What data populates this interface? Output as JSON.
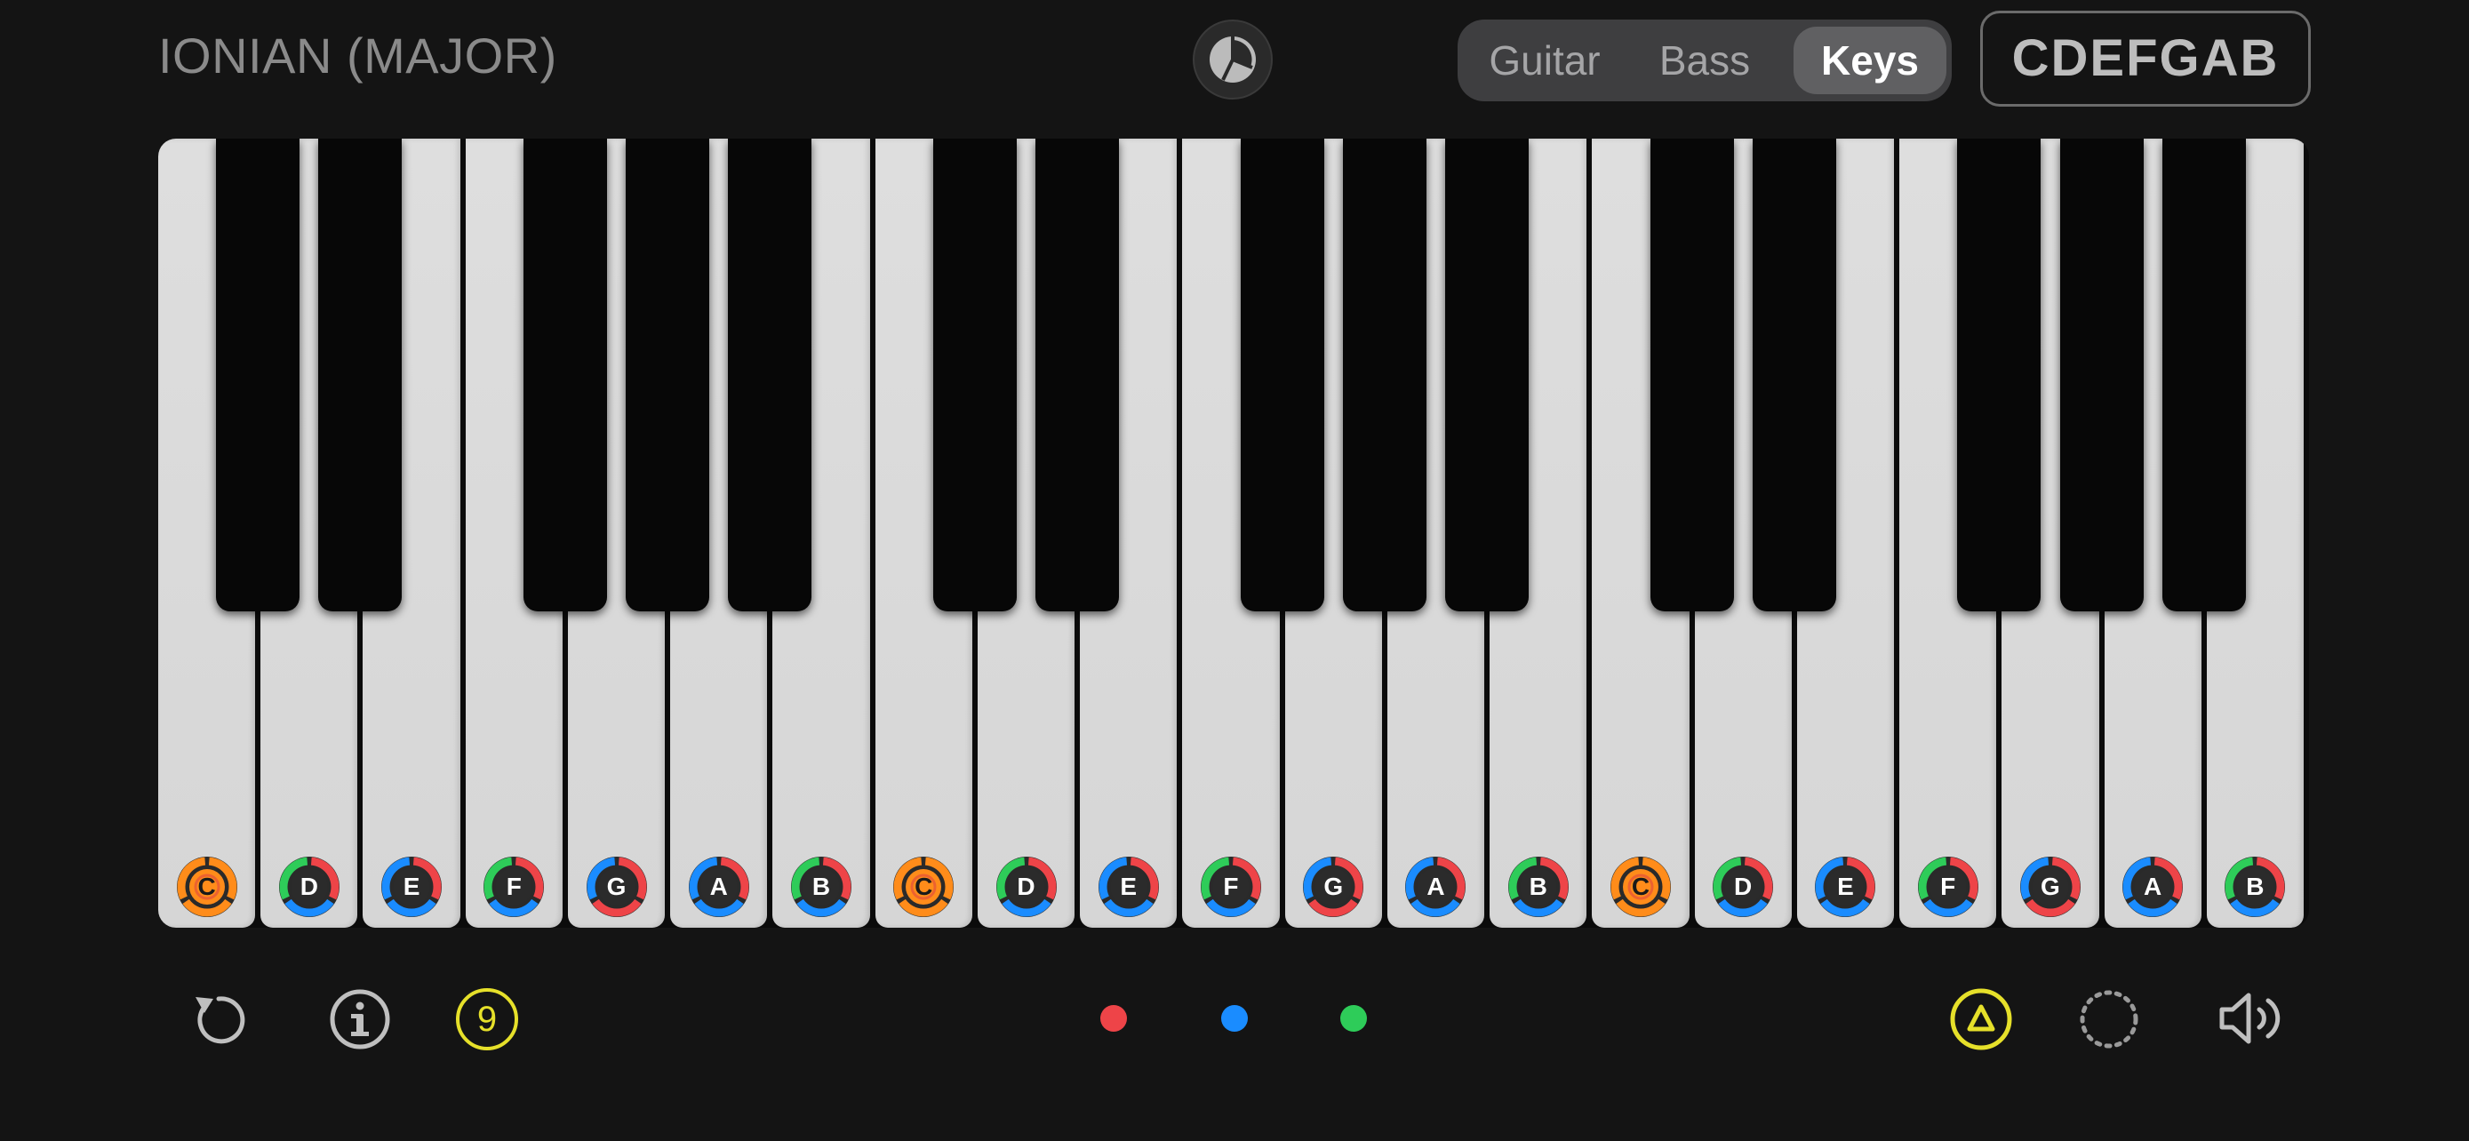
{
  "header": {
    "scale_title": "IONIAN (MAJOR)",
    "instrument_tabs": [
      {
        "label": "Guitar",
        "active": false
      },
      {
        "label": "Bass",
        "active": false
      },
      {
        "label": "Keys",
        "active": true
      }
    ],
    "note_names_button": "CDEFGAB",
    "theme_icon": "pie-chart-icon"
  },
  "keyboard": {
    "white_keys": [
      "C",
      "D",
      "E",
      "F",
      "G",
      "A",
      "B",
      "C",
      "D",
      "E",
      "F",
      "G",
      "A",
      "B",
      "C",
      "D",
      "E",
      "F",
      "G",
      "A",
      "B"
    ],
    "root_note": "C"
  },
  "footer": {
    "left_icons": [
      "reset-icon",
      "info-icon"
    ],
    "count_badge": "9",
    "color_dots": [
      "#ee4448",
      "#1a8cff",
      "#2ecc59"
    ],
    "right_icons": [
      "triangle-icon",
      "dotted-circle-icon",
      "speaker-icon"
    ]
  },
  "colors": {
    "red": "#ee4448",
    "blue": "#1a8cff",
    "green": "#2ecc59",
    "orange": "#ff8c1a",
    "yellow": "#e6e02a"
  }
}
